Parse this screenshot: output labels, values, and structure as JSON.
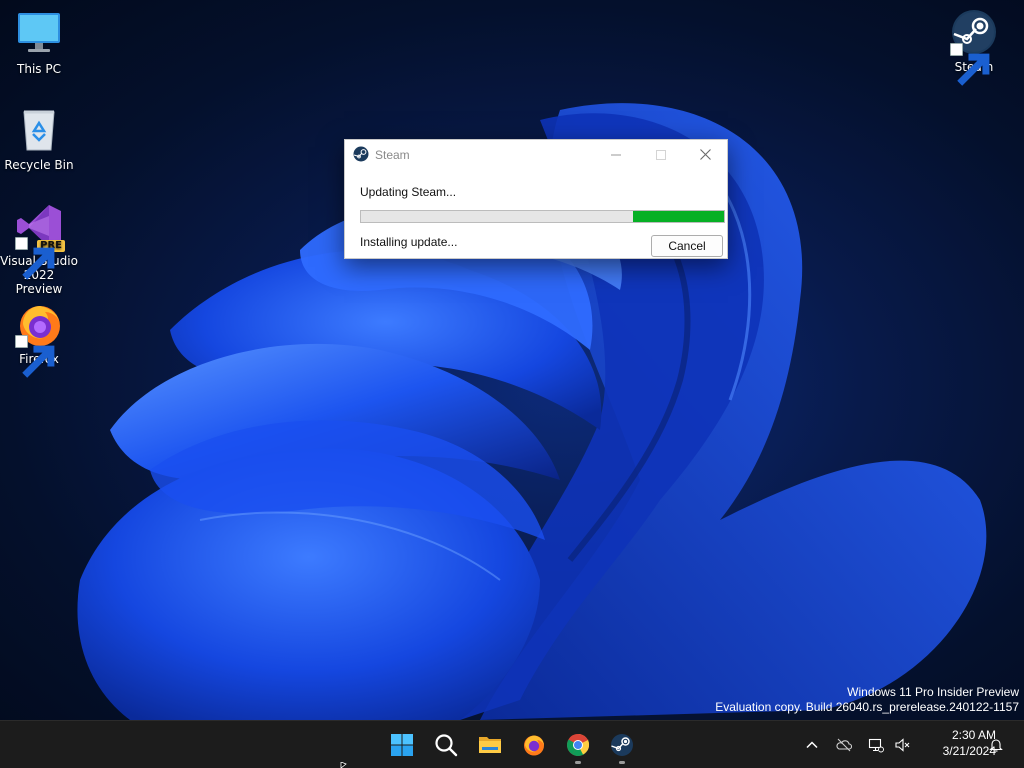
{
  "desktop": {
    "icons": [
      {
        "label": "This PC"
      },
      {
        "label": "Recycle Bin"
      },
      {
        "label": "Visual Studio 2022 Preview",
        "badge": "PRE"
      },
      {
        "label": "Firefox"
      },
      {
        "label": "Steam"
      }
    ]
  },
  "watermark": {
    "line1": "Windows 11 Pro Insider Preview",
    "line2": "Evaluation copy. Build 26040.rs_prerelease.240122-1157"
  },
  "dialog": {
    "title": "Steam",
    "status_main": "Updating Steam...",
    "status_sub": "Installing update...",
    "cancel_label": "Cancel",
    "progress_percent": 25,
    "progress_color": "#06b025"
  },
  "taskbar": {
    "apps": [
      "start-icon",
      "search-icon",
      "file-explorer-icon",
      "firefox-icon",
      "chrome-icon",
      "steam-icon"
    ],
    "tray_icons": [
      "chevron-up-icon",
      "onedrive-icon",
      "network-icon",
      "volume-muted-icon",
      "notifications-icon"
    ]
  },
  "clock": {
    "time": "2:30 AM",
    "date": "3/21/2024"
  },
  "colors": {
    "accent_blue": "#1f5cff",
    "taskbar_bg": "#1c1c1c"
  }
}
